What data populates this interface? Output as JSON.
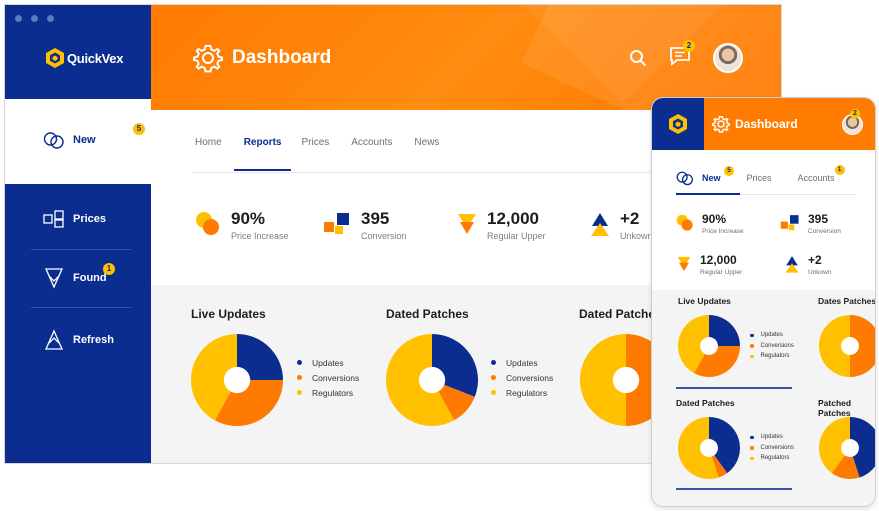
{
  "app": {
    "logo": "QuickVex",
    "title": "Dashboard"
  },
  "colors": {
    "navy": "#0a2d8f",
    "orange": "#ff7a00",
    "yellow": "#ffc000",
    "white": "#ffffff"
  },
  "header": {
    "notifications_badge": "2"
  },
  "sidebar": {
    "items": [
      {
        "label": "New",
        "icon": "circles-icon",
        "badge": "5",
        "active": true
      },
      {
        "label": "Prices",
        "icon": "price-grid-icon"
      },
      {
        "label": "Found",
        "icon": "found-icon",
        "badge": "1"
      },
      {
        "label": "Refresh",
        "icon": "refresh-icon"
      }
    ]
  },
  "tabs": [
    "Home",
    "Reports",
    "Prices",
    "Accounts",
    "News"
  ],
  "active_tab": "Reports",
  "stats": [
    {
      "value": "90%",
      "caption": "Price Increase",
      "icon": "circles-stat-icon"
    },
    {
      "value": "395",
      "caption": "Conversion",
      "icon": "squares-stat-icon"
    },
    {
      "value": "12,000",
      "caption": "Regular Upper",
      "icon": "triangle-down-icon"
    },
    {
      "value": "+2",
      "caption": "Unkown",
      "icon": "triangle-up-icon"
    }
  ],
  "legend": [
    "Updates",
    "Conversions",
    "Regulators"
  ],
  "charts": [
    {
      "title": "Live Updates",
      "slices": [
        0.25,
        0.33,
        0.42
      ]
    },
    {
      "title": "Dated Patches",
      "slices": [
        0.31,
        0.11,
        0.58
      ]
    },
    {
      "title": "Dated Patches",
      "slices": [
        0.0,
        0.5,
        0.5
      ]
    }
  ],
  "mobile": {
    "title": "Dashboard",
    "avatar_badge": "2",
    "tabs": [
      {
        "label": "New",
        "badge": "5",
        "active": true
      },
      {
        "label": "Prices"
      },
      {
        "label": "Accounts",
        "badge": "1"
      }
    ],
    "stats": [
      {
        "value": "90%",
        "caption": "Price Increase"
      },
      {
        "value": "395",
        "caption": "Conversion"
      },
      {
        "value": "12,000",
        "caption": "Regular Upper"
      },
      {
        "value": "+2",
        "caption": "Unkown"
      }
    ],
    "legend": [
      "Updates",
      "Conversions",
      "Regulators"
    ],
    "charts": [
      {
        "title": "Live Updates",
        "slices": [
          0.25,
          0.33,
          0.42
        ]
      },
      {
        "title": "Dates Patches",
        "slices": [
          0.0,
          0.5,
          0.5
        ]
      },
      {
        "title": "Dated Patches",
        "slices": [
          0.4,
          0.05,
          0.55
        ]
      },
      {
        "title": "Patched Patches",
        "slices": [
          0.45,
          0.15,
          0.4
        ]
      }
    ]
  }
}
